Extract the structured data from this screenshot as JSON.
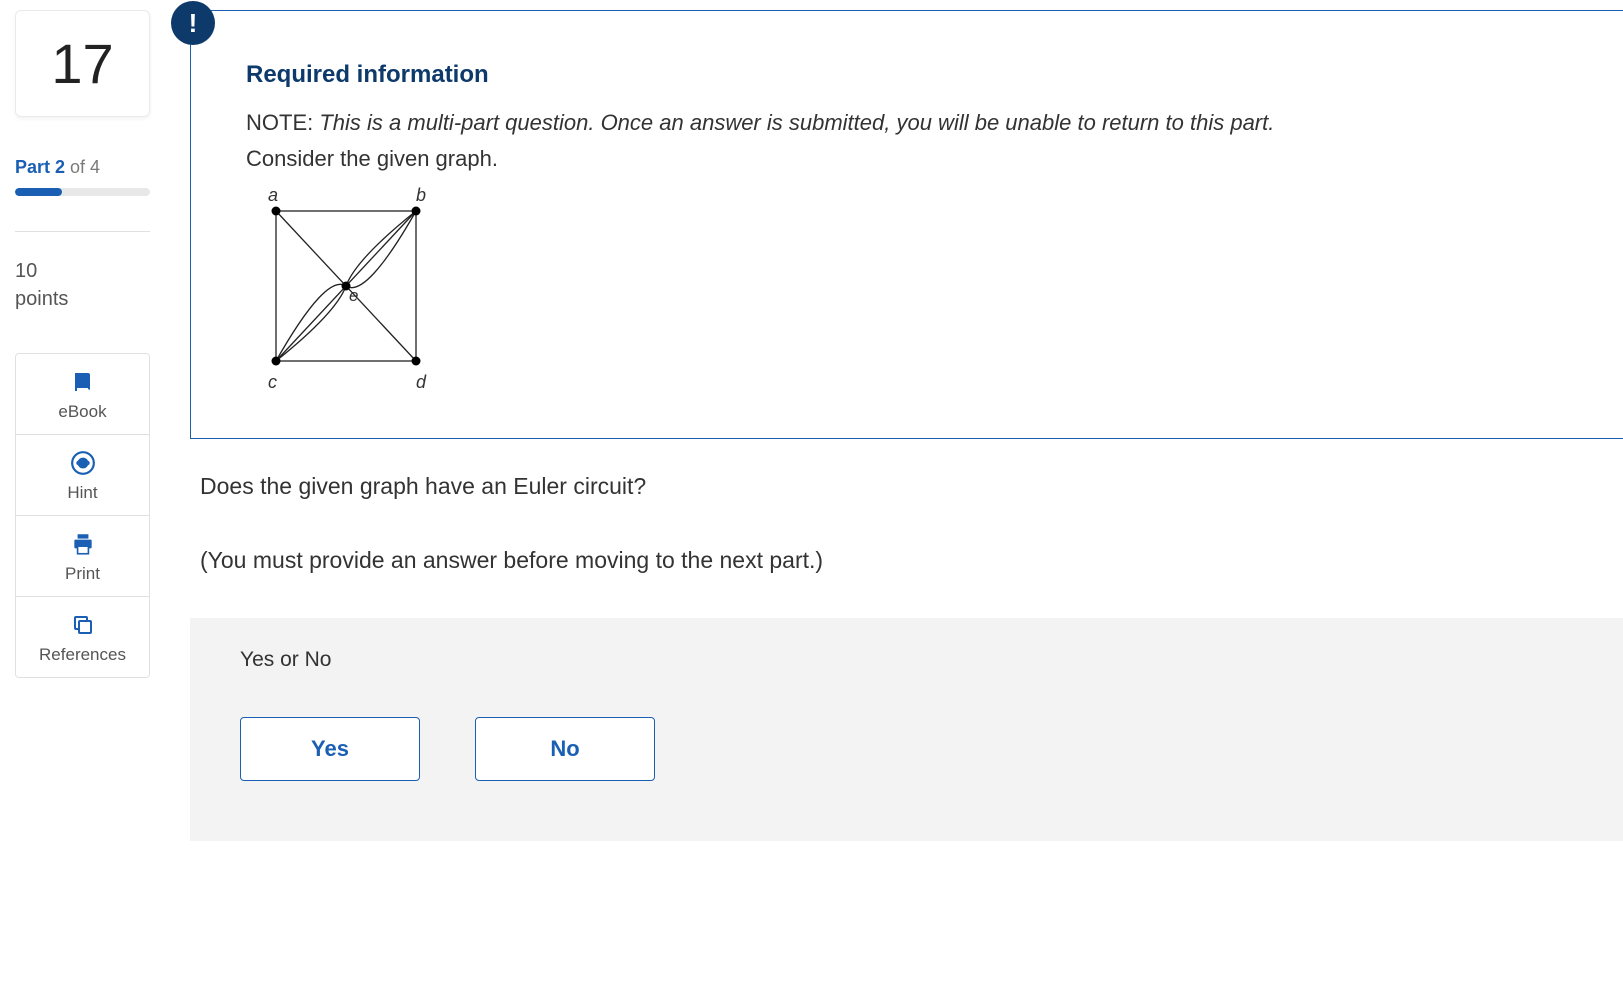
{
  "sidebar": {
    "question_number": "17",
    "part_strong": "Part 2",
    "part_rest": " of 4",
    "points_value": "10",
    "points_label": "points",
    "tools": {
      "ebook": "eBook",
      "hint": "Hint",
      "print": "Print",
      "references": "References"
    }
  },
  "info": {
    "badge": "!",
    "title": "Required information",
    "note_prefix": "NOTE: ",
    "note_italic": "This is a multi-part question. Once an answer is submitted, you will be unable to return to this part.",
    "consider": "Consider the given graph.",
    "graph_labels": {
      "a": "a",
      "b": "b",
      "c": "c",
      "d": "d",
      "e": "e"
    }
  },
  "question": {
    "line1": "Does the given graph have an Euler circuit?",
    "line2": "(You must provide an answer before moving to the next part.)"
  },
  "answer": {
    "prompt": "Yes or No",
    "yes": "Yes",
    "no": "No"
  }
}
